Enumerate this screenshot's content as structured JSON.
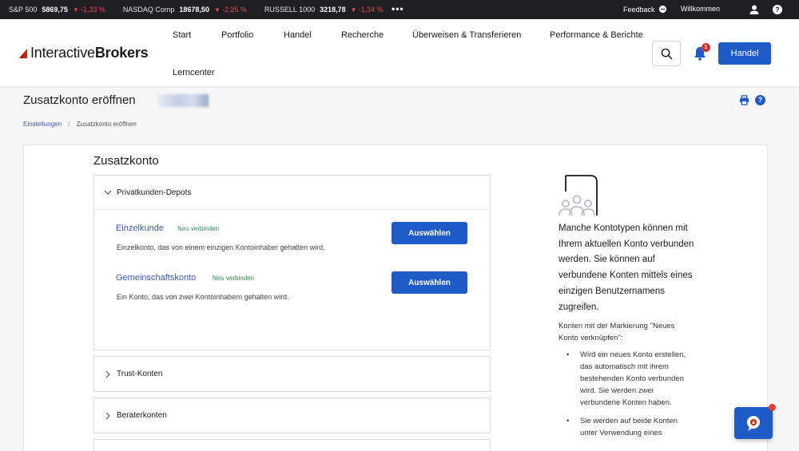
{
  "ticker": {
    "items": [
      {
        "name": "S&P 500",
        "value": "5869,75",
        "change": "-1,33 %"
      },
      {
        "name": "NASDAQ Comp",
        "value": "18678,50",
        "change": "-2,25 %"
      },
      {
        "name": "RUSSELL 1000",
        "value": "3218,78",
        "change": "-1,34 %"
      }
    ],
    "more": "•••",
    "feedback": "Feedback",
    "welcome": "Willkommen",
    "help": "?"
  },
  "header": {
    "logo": {
      "part1": "Interactive",
      "part2": "Brokers"
    },
    "nav": [
      "Start",
      "Portfolio",
      "Handel",
      "Recherche",
      "Überweisen & Transferieren",
      "Performance & Berichte",
      "Lerncenter"
    ],
    "notification_count": "1",
    "handel_button": "Handel"
  },
  "page": {
    "title": "Zusatzkonto eröffnen",
    "help": "?",
    "breadcrumb": {
      "link": "Einstellungen",
      "sep": "/",
      "current": "Zusatzkonto eröffnen"
    }
  },
  "main": {
    "section_title": "Zusatzkonto",
    "panels": [
      {
        "label": "Privatkunden-Depots",
        "accounts": [
          {
            "title": "Einzelkunde",
            "badge": "Neu verbinden",
            "description": "Einzelkonto, das von einem einzigen Kontoinhaber gehalten wird.",
            "button": "Auswählen"
          },
          {
            "title": "Gemeinschaftskonto",
            "badge": "Neu verbinden",
            "description": "Ein Konto, das von zwei Kontoinhabern gehalten wird.",
            "button": "Auswählen"
          }
        ]
      },
      {
        "label": "Trust-Konten"
      },
      {
        "label": "Beraterkonten"
      }
    ]
  },
  "info": {
    "main": "Manche Kontotypen können mit Ihrem aktuellen Konto verbunden werden. Sie können auf verbundene Konten mittels eines einzigen Benutzernamens zugreifen.",
    "sub": "Konten mit der Markierung \"Neues Konto verknüpfen\":",
    "bullets": [
      "Wird ein neues Konto erstellen, das automatisch mit ihrem bestehenden Konto verbunden wird. Sie werden zwei verbundene Konten haben.",
      "Sie werden auf beide Konten unter Verwendung eines"
    ]
  },
  "colors": {
    "accent": "#1f5bc6",
    "link": "#3b5bb5",
    "negative": "#e5484d",
    "badge_green": "#2e8b57",
    "ticker_bg": "#1f1f23"
  }
}
